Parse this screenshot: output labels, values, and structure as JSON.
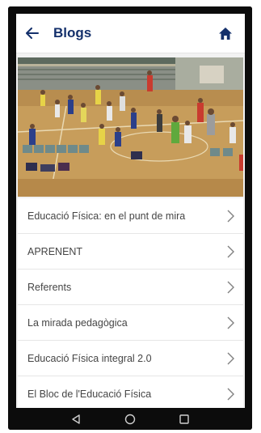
{
  "appbar": {
    "title": "Blogs",
    "back_icon": "arrow-left-icon",
    "home_icon": "home-icon",
    "title_color": "#14306b"
  },
  "hero": {
    "image": "basketball-court-photo"
  },
  "blogs": {
    "items": [
      {
        "label": "Educació Física: en el punt de mira"
      },
      {
        "label": "APRENENT"
      },
      {
        "label": "Referents"
      },
      {
        "label": "La mirada pedagògica"
      },
      {
        "label": "Educació Física integral 2.0"
      },
      {
        "label": "El Bloc de l'Educació Física"
      }
    ],
    "chevron_icon": "chevron-right-icon"
  },
  "navbar": {
    "back_icon": "triangle-back-icon",
    "home_icon": "circle-home-icon",
    "recents_icon": "square-recents-icon"
  }
}
